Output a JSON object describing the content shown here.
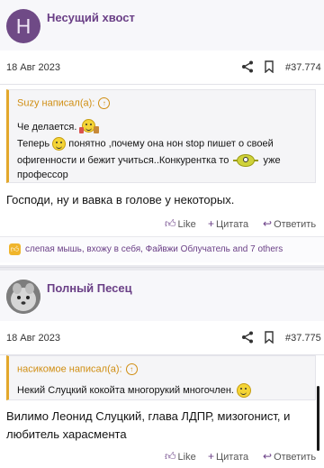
{
  "posts": [
    {
      "author": "Несущий хвост",
      "avatar_letter": "H",
      "avatar_color": "#6f4a86",
      "date": "18 Авг 2023",
      "number": "#37.774",
      "quote": {
        "header": "Suzy написал(а):",
        "lines": [
          "Че делается.",
          "Теперь",
          "понятно ,почему она нон stop пишет о своей",
          "офигенности и бежит учиться..Конкурентка то",
          "уже",
          "профессор"
        ]
      },
      "body": "Господи, ну и вавка в голове у некоторых.",
      "actions": {
        "like": "Like",
        "quote": "Цитата",
        "reply": "Ответить"
      },
      "reactions_text": "слепая мышь, вхожу в себя, Файвжи Облучатель and 7 others"
    },
    {
      "author": "Полный Песец",
      "date": "18 Авг 2023",
      "number": "#37.775",
      "quote": {
        "header": "насикомое написал(а):",
        "lines": [
          "Некий Слуцкий кокойта многорукий многочлен."
        ]
      },
      "body_lines": [
        "Вилимо Леонид Слуцкий, глава ЛДПР, мизогонист, и",
        "любитель харасмента"
      ],
      "actions": {
        "like": "Like",
        "quote": "Цитата",
        "reply": "Ответить"
      }
    }
  ],
  "colors": {
    "accent": "#6a3f86",
    "quote_accent": "#e3a82b"
  },
  "icons": [
    "share-icon",
    "bookmark-icon",
    "thumbs-up-icon",
    "plus-icon",
    "reply-icon",
    "arrow-up-icon"
  ]
}
